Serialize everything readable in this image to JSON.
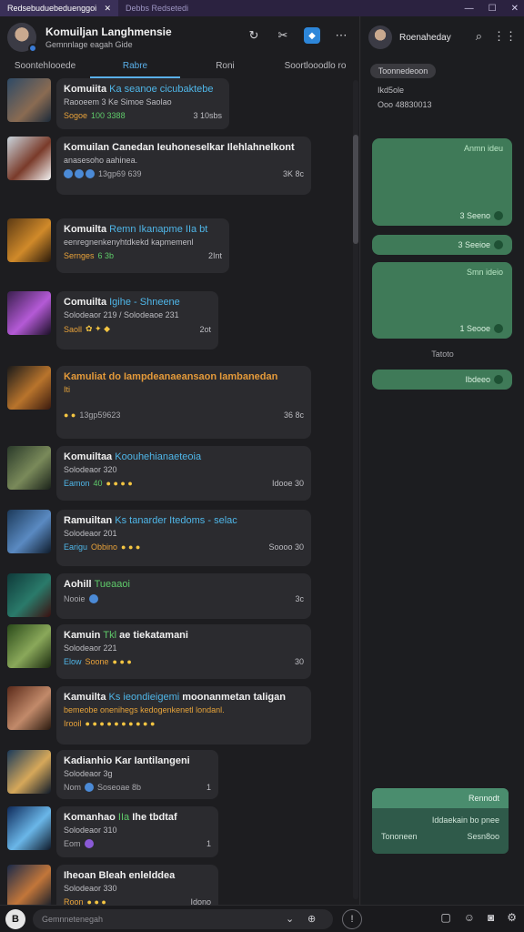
{
  "titlebar": {
    "tab_active": "Redsebuduebeduenggoi",
    "tab_inactive": "Debbs Redsetedi",
    "minimize": "—",
    "maximize": "☐",
    "close": "✕"
  },
  "left_header": {
    "title": "Komuiljan Langhmensie",
    "subtitle": "Gemnnlage eagah Gide",
    "icons": [
      "refresh-icon",
      "mute-icon",
      "grid-icon",
      "more-icon"
    ]
  },
  "left_tabs": [
    {
      "label": "Soontehlooede",
      "active": false
    },
    {
      "label": "Rabre",
      "active": true
    },
    {
      "label": "Roni",
      "active": false
    },
    {
      "label": "Soortlooodlo ro",
      "active": false
    }
  ],
  "feed": [
    {
      "title": "Komuiita",
      "title_hl": "Ka seanoe cicubaktebe",
      "sub": "Raooeem 3 Ke Simoe Saolao",
      "meta_left": "Sogoe",
      "meta_g": "100 3388",
      "meta_right": "3 10sbs",
      "thumb": "#355a7a"
    },
    {
      "title": "Komuilan Canedan Ieuhoneselkar Ilehlahnelkont",
      "sub": "anasesoho aahinea.",
      "meta_left": "",
      "meta_g": "",
      "meta_date": "13gp69 639",
      "meta_right": "3K 8c"
    },
    {
      "title": "Komuilta",
      "title_hl": "Remn Ikanapme IIa bt",
      "sub": "eenregnenkenyhtdkekd kapmemenl",
      "meta_left": "Sernges",
      "meta_g": "6 3b",
      "meta_right": "2Int"
    },
    {
      "title": "Comuilta",
      "title_hl": "Igihe - Shneene",
      "sub": "Solodeaor 219 / Solodeaoe 231",
      "meta_left": "Saoll",
      "meta_g": "",
      "meta_right": "2ot"
    },
    {
      "title": "Kamuliat do Iampdeanaeansaon Iambanedan",
      "sub": "Iti",
      "meta_left": "",
      "meta_g": "",
      "meta_date": "13gp59623",
      "meta_right": "36 8c",
      "orange": true
    },
    {
      "title": "Komuiltaa",
      "title_hl": "Koouhehianaeteoia",
      "sub": "Solodeaor 320",
      "meta_left": "Eamon",
      "meta_g": "40",
      "meta_right": "Idooe 30"
    },
    {
      "title": "Ramuiltan",
      "title_hl": "Ks tanarder Itedoms - selac",
      "sub": "Solodeaor 201",
      "meta_left": "Earigu",
      "meta_g": "",
      "meta_orange": "Obbino",
      "meta_right": "Soooo 30"
    },
    {
      "title": "Aohill",
      "title_hl": "Tueaaoi",
      "sub": "Nooie",
      "meta_left": "",
      "meta_g": "",
      "meta_right": "3c"
    },
    {
      "title": "Kamuin",
      "title_hl": "Tkl",
      "title_rest": "ae tiekatamani",
      "sub": "Solodeaor 221",
      "meta_left": "Elow",
      "meta_g": "",
      "meta_orange": "Soone",
      "meta_right": "30"
    },
    {
      "title": "Kamuilta",
      "title_hl": "Ks ieondieigemi",
      "title_rest": "moonanmetan taligan",
      "sub": "bemeobe onenihegs kedogenkenetl londanl.",
      "meta_left": "Irooil",
      "meta_g": "",
      "meta_right": "",
      "orange_sub": true
    },
    {
      "title": "Kadianhio Kar Iantilangeni",
      "sub": "Solodeaor 3g",
      "meta_left": "Nom",
      "meta_g": "",
      "meta_date": "Soseoae 8b",
      "meta_right": "1"
    },
    {
      "title": "Komanhao",
      "title_hl": "IIa",
      "title_rest": "Ihe tbdtaf",
      "sub": "Solodeaor 310",
      "meta_left": "Eom",
      "meta_g": "",
      "meta_right": "1"
    },
    {
      "title": "Iheoan Bleah enlelddea",
      "sub": "Solodeaor 330",
      "meta_left": "Roon",
      "meta_g": "",
      "meta_right": "Idono"
    }
  ],
  "right_header": {
    "name": "Roenaheday",
    "icons": [
      "search-icon",
      "grid-icon"
    ]
  },
  "right_panel": {
    "pill": "Toonnedeoon",
    "meta1": "Ikd5ole",
    "meta2": "Ooo 48830013",
    "bubbles": [
      {
        "top_text": "Anmn ideu",
        "bottom_text": "3 Seeno"
      },
      {
        "top_text": "",
        "bottom_text": "3 Seeioe"
      },
      {
        "top_text": "Smn ideio",
        "bottom_text": "1 Seooe"
      },
      {
        "top_text": "",
        "bottom_text": "Ibdeeo"
      }
    ],
    "divider": "Tatoto",
    "teal_head": "Rennodt",
    "teal_line1": "Iddaekain bo pnee",
    "teal_line2_left": "Tononeen",
    "teal_line2_right": "Sesn8oo"
  },
  "bottombar": {
    "logo_text": "B",
    "input_placeholder": "Gemnnetenegah",
    "icons": [
      "sticker-icon",
      "emoji-icon",
      "gif-icon",
      "settings-icon"
    ]
  }
}
